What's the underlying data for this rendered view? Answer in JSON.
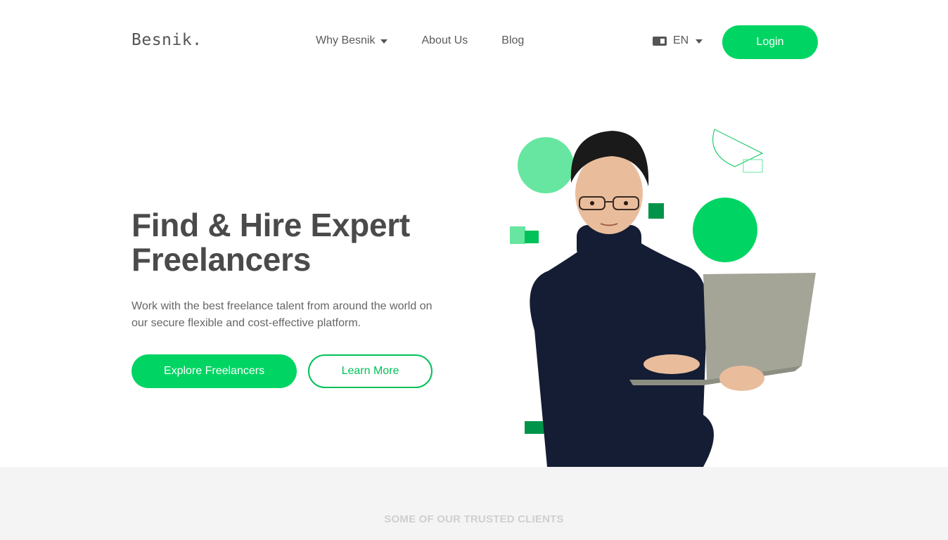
{
  "brand": {
    "logo": "Besnik."
  },
  "nav": {
    "items": [
      {
        "label": "Why Besnik",
        "has_dropdown": true
      },
      {
        "label": "About Us",
        "has_dropdown": false
      },
      {
        "label": "Blog",
        "has_dropdown": false
      }
    ]
  },
  "language": {
    "icon": "translate-icon",
    "selected": "EN"
  },
  "auth": {
    "login_label": "Login"
  },
  "hero": {
    "title_line1": "Find & Hire Expert",
    "title_line2": "Freelancers",
    "description": "Work with the best freelance talent from around the world on our secure flexible and cost-effective platform.",
    "primary_cta": "Explore Freelancers",
    "secondary_cta": "Learn More"
  },
  "clients": {
    "title": "SOME OF OUR TRUSTED CLIENTS"
  },
  "colors": {
    "accent": "#00d563",
    "accent_dark": "#00944a",
    "accent_light": "#66e6a0",
    "text": "#4a4a4a",
    "band": "#f4f4f4"
  }
}
